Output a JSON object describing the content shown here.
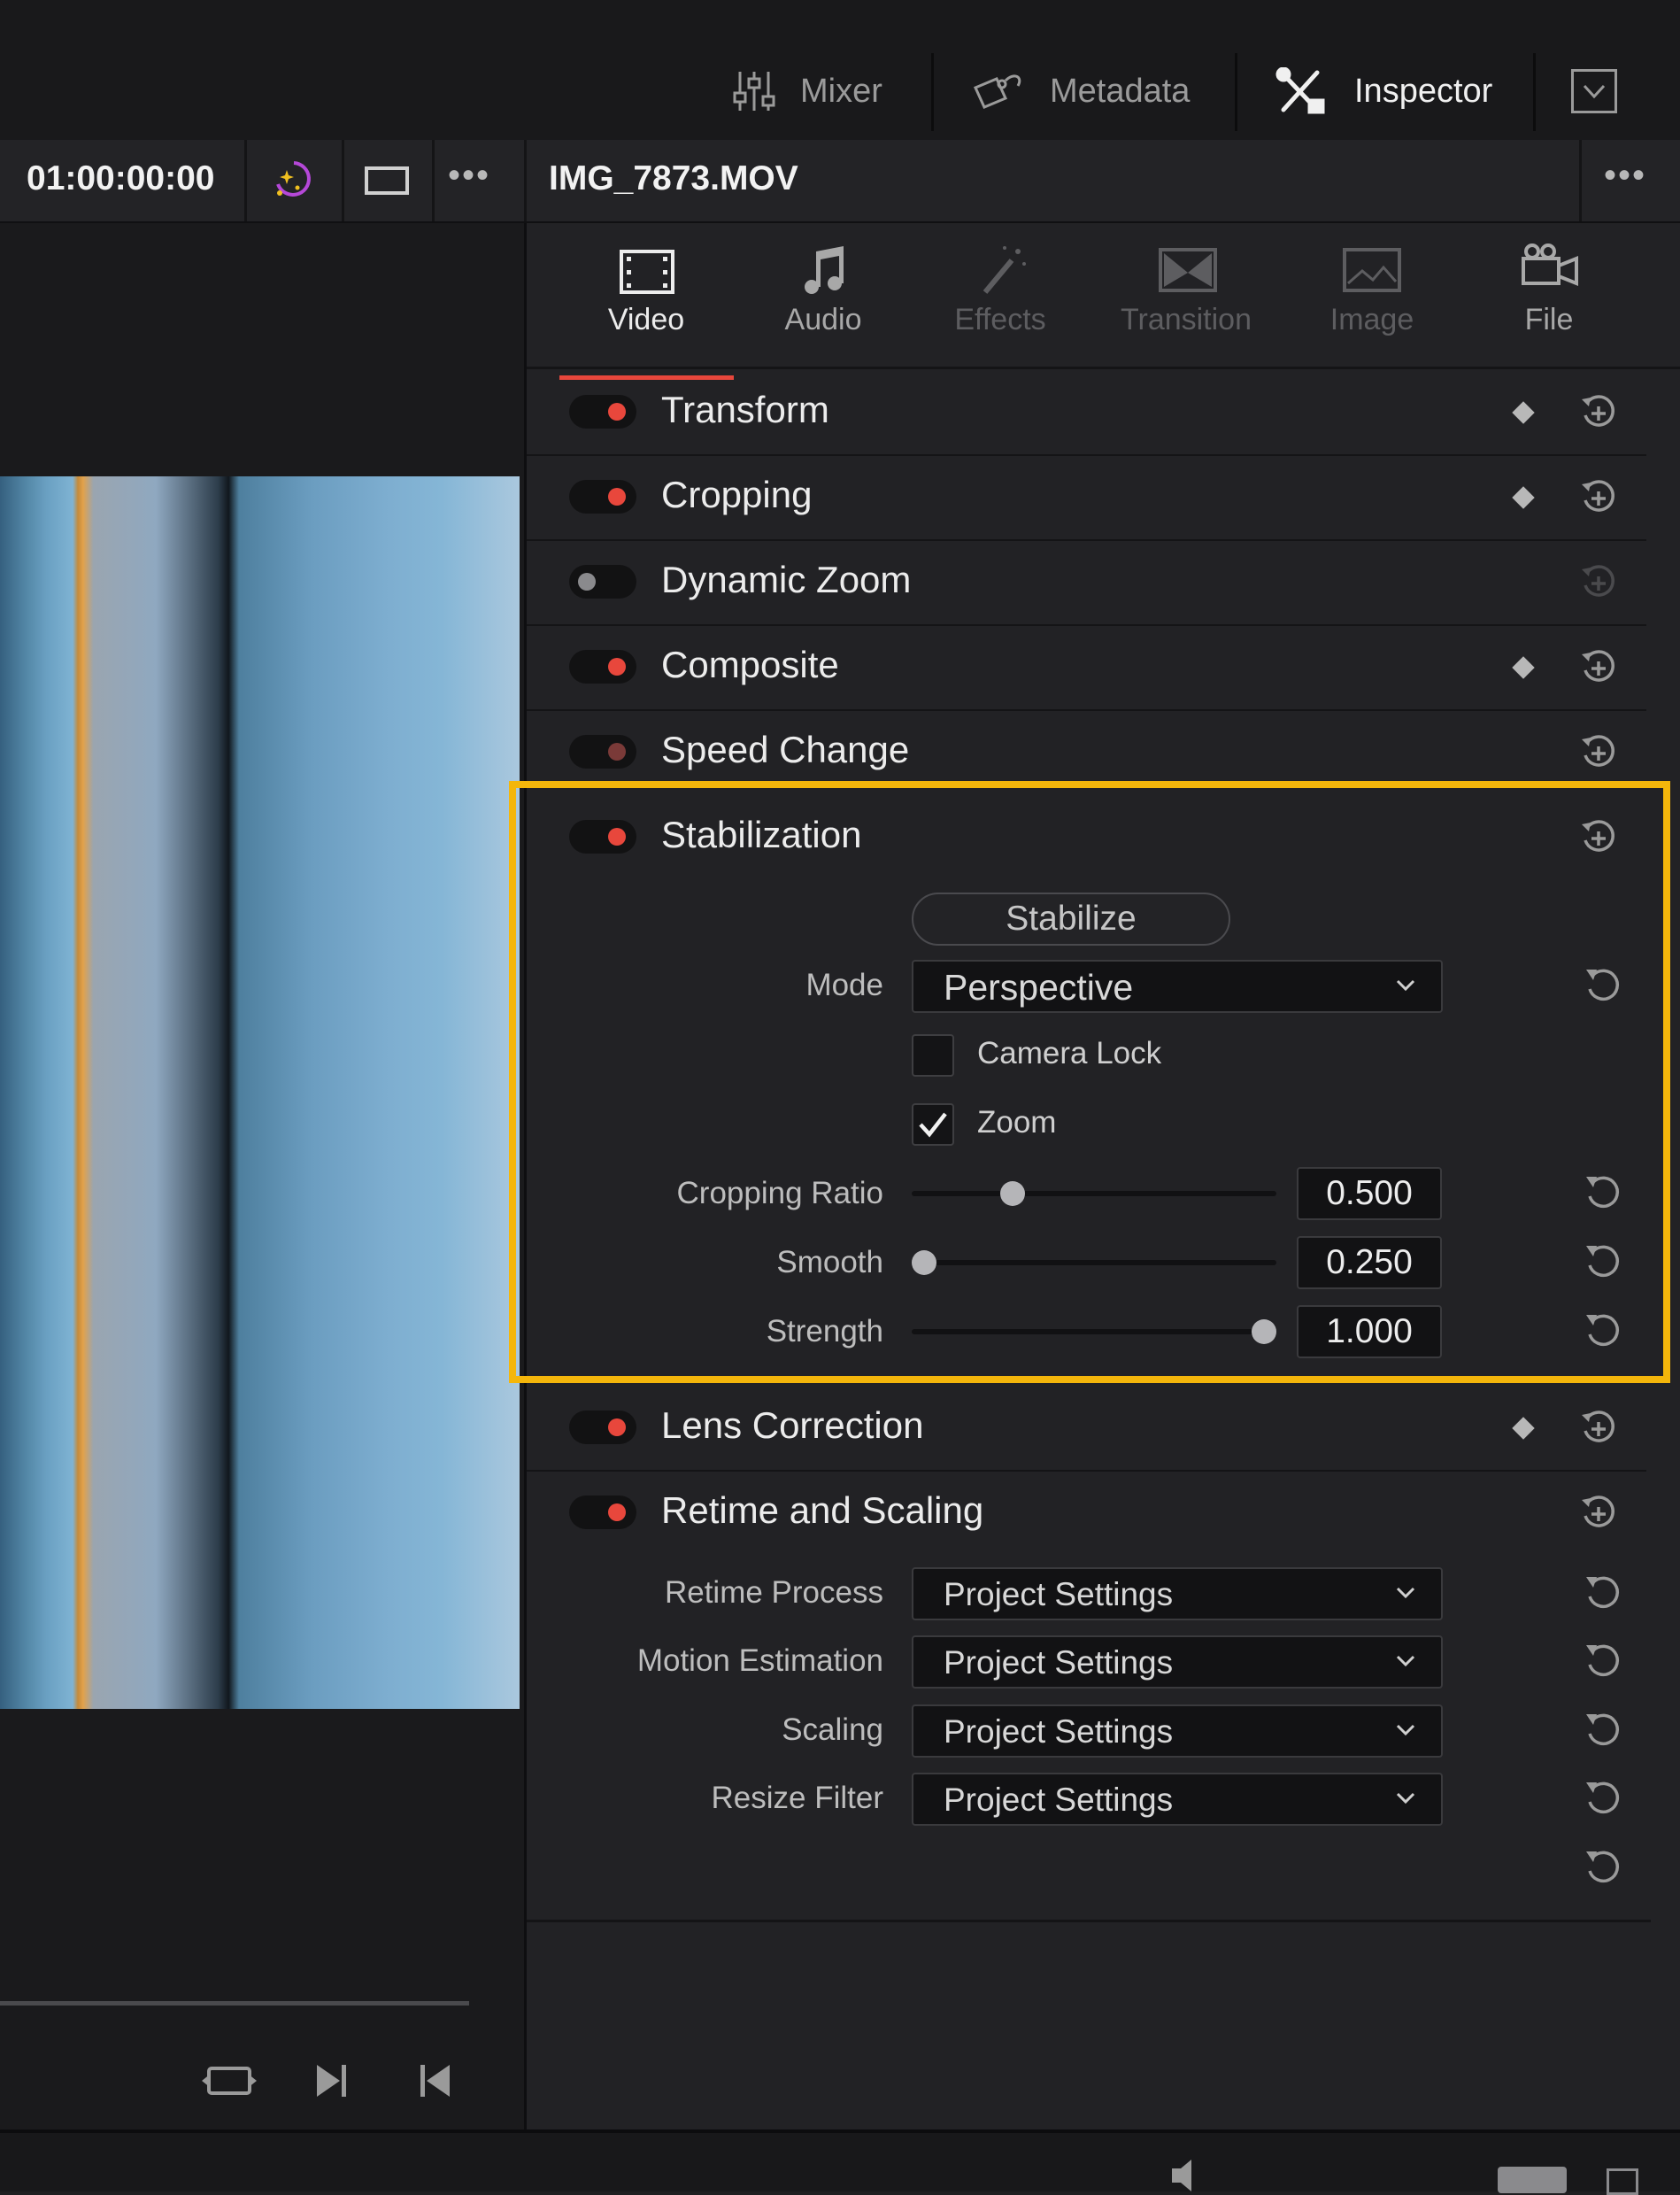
{
  "topbar": {
    "mixer_label": "Mixer",
    "metadata_label": "Metadata",
    "inspector_label": "Inspector"
  },
  "viewer": {
    "timecode": "01:00:00:00"
  },
  "inspector": {
    "clip_name": "IMG_7873.MOV",
    "tabs": [
      {
        "label": "Video",
        "state": "active"
      },
      {
        "label": "Audio",
        "state": "enabled"
      },
      {
        "label": "Effects",
        "state": "disabled"
      },
      {
        "label": "Transition",
        "state": "disabled"
      },
      {
        "label": "Image",
        "state": "disabled"
      },
      {
        "label": "File",
        "state": "enabled"
      }
    ],
    "sections": {
      "transform": "Transform",
      "cropping": "Cropping",
      "dynamic_zoom": "Dynamic Zoom",
      "composite": "Composite",
      "speed_change": "Speed Change",
      "stabilization": "Stabilization",
      "lens_correction": "Lens Correction",
      "retime_scaling": "Retime and Scaling"
    },
    "stabilization": {
      "stabilize_button": "Stabilize",
      "mode_label": "Mode",
      "mode_value": "Perspective",
      "camera_lock_label": "Camera Lock",
      "camera_lock_checked": false,
      "zoom_label": "Zoom",
      "zoom_checked": true,
      "cropping_ratio_label": "Cropping Ratio",
      "cropping_ratio_value": "0.500",
      "cropping_ratio_fraction": 0.26,
      "smooth_label": "Smooth",
      "smooth_value": "0.250",
      "smooth_fraction": 0.0,
      "strength_label": "Strength",
      "strength_value": "1.000",
      "strength_fraction": 1.0
    },
    "retime": {
      "retime_process_label": "Retime Process",
      "retime_process_value": "Project Settings",
      "motion_estimation_label": "Motion Estimation",
      "motion_estimation_value": "Project Settings",
      "scaling_label": "Scaling",
      "scaling_value": "Project Settings",
      "resize_filter_label": "Resize Filter",
      "resize_filter_value": "Project Settings"
    }
  },
  "colors": {
    "highlight": "#f4b60b",
    "toggle_on": "#e8473c",
    "accent_tab": "#e8473c"
  }
}
